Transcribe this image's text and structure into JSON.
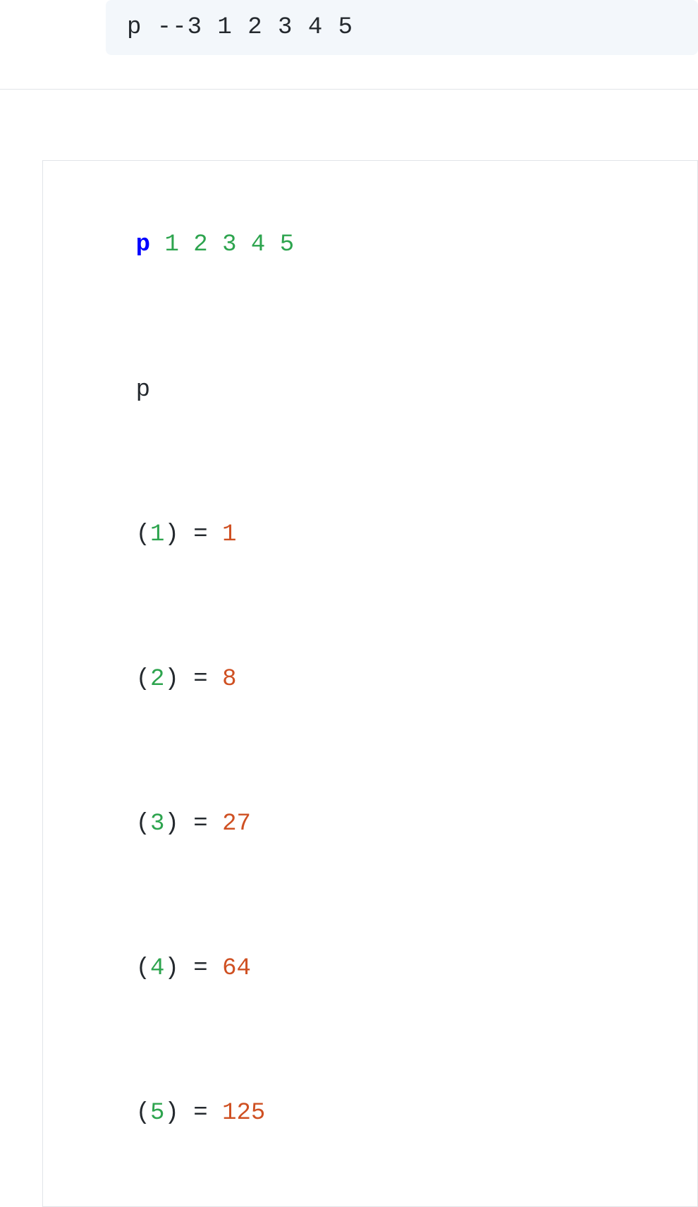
{
  "command": "p --3 1 2 3 4 5",
  "output": {
    "call": {
      "func": "p",
      "args": [
        "1",
        "2",
        "3",
        "4",
        "5"
      ]
    },
    "echo": "p",
    "results": [
      {
        "arg": "1",
        "value": "1"
      },
      {
        "arg": "2",
        "value": "8"
      },
      {
        "arg": "3",
        "value": "27"
      },
      {
        "arg": "4",
        "value": "64"
      },
      {
        "arg": "5",
        "value": "125"
      }
    ],
    "symbols": {
      "lparen": "(",
      "rparen": ")",
      "equals": " = "
    }
  }
}
